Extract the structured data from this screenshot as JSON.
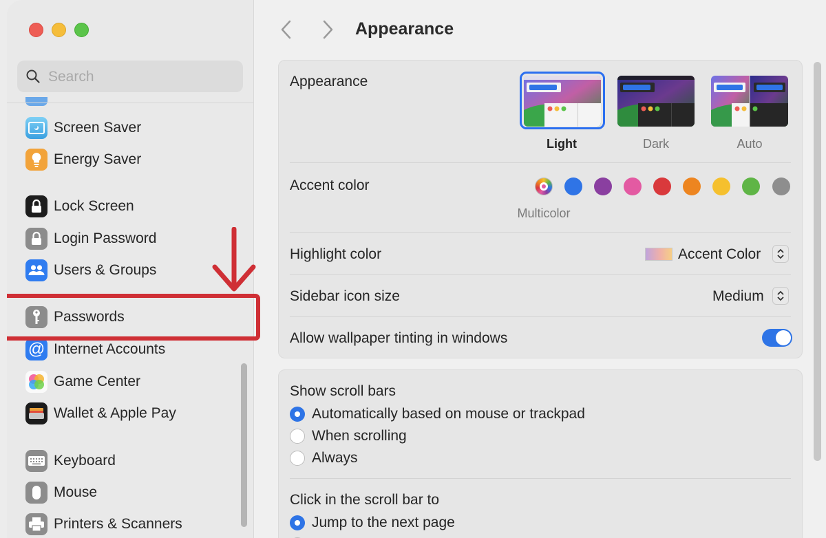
{
  "window": {
    "title": "Appearance"
  },
  "sidebar": {
    "search_placeholder": "Search",
    "items": [
      {
        "label": "Screen Saver",
        "icon": "screen-saver-icon"
      },
      {
        "label": "Energy Saver",
        "icon": "energy-saver-icon"
      },
      {
        "label": "Lock Screen",
        "icon": "lock-screen-icon"
      },
      {
        "label": "Login Password",
        "icon": "login-password-icon"
      },
      {
        "label": "Users & Groups",
        "icon": "users-groups-icon"
      },
      {
        "label": "Passwords",
        "icon": "key-icon",
        "highlighted": true
      },
      {
        "label": "Internet Accounts",
        "icon": "at-sign-icon"
      },
      {
        "label": "Game Center",
        "icon": "game-center-icon"
      },
      {
        "label": "Wallet & Apple Pay",
        "icon": "wallet-icon"
      },
      {
        "label": "Keyboard",
        "icon": "keyboard-icon"
      },
      {
        "label": "Mouse",
        "icon": "mouse-icon"
      },
      {
        "label": "Printers & Scanners",
        "icon": "printer-icon"
      }
    ]
  },
  "appearance": {
    "label": "Appearance",
    "options": [
      {
        "label": "Light",
        "selected": true
      },
      {
        "label": "Dark",
        "selected": false
      },
      {
        "label": "Auto",
        "selected": false
      }
    ]
  },
  "accent": {
    "label": "Accent color",
    "selected_label": "Multicolor",
    "colors": [
      {
        "name": "Multicolor",
        "hex": "multicolor",
        "selected": true
      },
      {
        "name": "Blue",
        "hex": "#2f74e6"
      },
      {
        "name": "Purple",
        "hex": "#8a3fa0"
      },
      {
        "name": "Pink",
        "hex": "#e35aa2"
      },
      {
        "name": "Red",
        "hex": "#d9393c"
      },
      {
        "name": "Orange",
        "hex": "#ed8520"
      },
      {
        "name": "Yellow",
        "hex": "#f5c02e"
      },
      {
        "name": "Green",
        "hex": "#5fb546"
      },
      {
        "name": "Graphite",
        "hex": "#8e8e8e"
      }
    ]
  },
  "highlight": {
    "label": "Highlight color",
    "value": "Accent Color"
  },
  "icon_size": {
    "label": "Sidebar icon size",
    "value": "Medium"
  },
  "tinting": {
    "label": "Allow wallpaper tinting in windows",
    "enabled": true
  },
  "scroll_bars": {
    "label": "Show scroll bars",
    "options": [
      {
        "label": "Automatically based on mouse or trackpad",
        "selected": true
      },
      {
        "label": "When scrolling",
        "selected": false
      },
      {
        "label": "Always",
        "selected": false
      }
    ]
  },
  "click_scroll": {
    "label": "Click in the scroll bar to",
    "options": [
      {
        "label": "Jump to the next page",
        "selected": true
      }
    ]
  },
  "colors": {
    "accent": "#2e74e6",
    "annotation": "#cf2f35"
  }
}
